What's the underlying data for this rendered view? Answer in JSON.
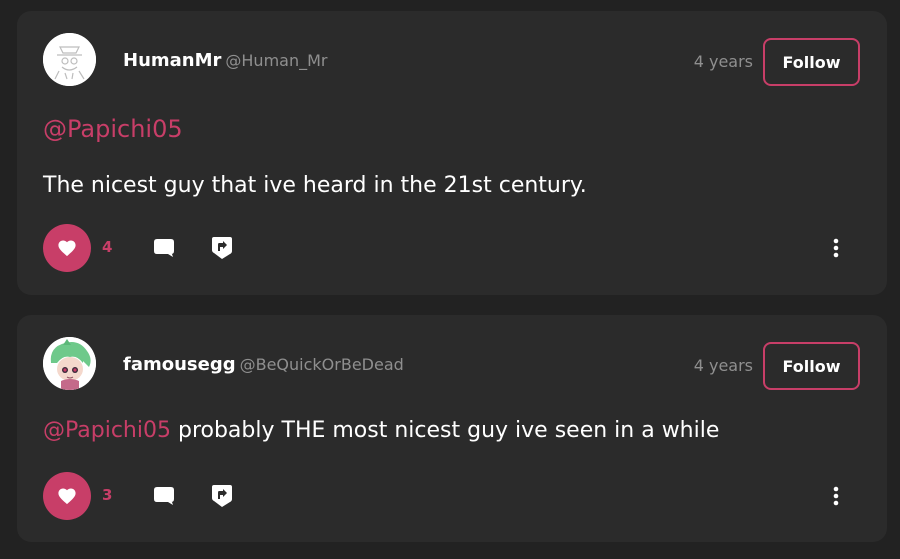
{
  "comments": [
    {
      "username": "HumanMr",
      "handle": "@Human_Mr",
      "time": "4 years",
      "follow_label": "Follow",
      "mention": "@Papichi05",
      "text": "The nicest guy that ive heard in the 21st century.",
      "likes": "4",
      "avatar_icon": "sketch-avatar-icon"
    },
    {
      "username": "famousegg",
      "handle": "@BeQuickOrBeDead",
      "time": "4 years",
      "follow_label": "Follow",
      "mention": "@Papichi05",
      "text": " probably THE most nicest guy ive seen in a while",
      "likes": "3",
      "avatar_icon": "anime-avatar-icon"
    }
  ],
  "colors": {
    "background": "#222222",
    "card": "#2b2b2b",
    "accent": "#c83e68",
    "muted": "#8f8f8f"
  }
}
